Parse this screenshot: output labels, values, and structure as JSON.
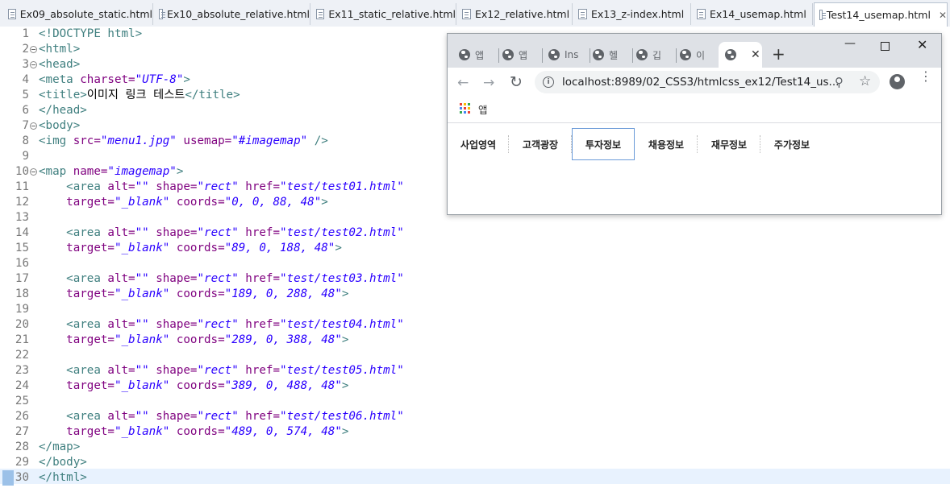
{
  "editor_tabs": [
    {
      "label": "Ex09_absolute_static.html",
      "active": false
    },
    {
      "label": "Ex10_absolute_relative.html",
      "active": false
    },
    {
      "label": "Ex11_static_relative.html",
      "active": false
    },
    {
      "label": "Ex12_relative.html",
      "active": false
    },
    {
      "label": "Ex13_z-index.html",
      "active": false
    },
    {
      "label": "Ex14_usemap.html",
      "active": false
    },
    {
      "label": "Test14_usemap.html",
      "active": true
    }
  ],
  "close_glyph": "✕",
  "code": {
    "line_numbers": [
      "1",
      "2",
      "3",
      "4",
      "5",
      "6",
      "7",
      "8",
      "9",
      "10",
      "11",
      "12",
      "13",
      "14",
      "15",
      "16",
      "17",
      "18",
      "19",
      "20",
      "21",
      "22",
      "23",
      "24",
      "25",
      "26",
      "27",
      "28",
      "29",
      "30"
    ],
    "line_1": "<!DOCTYPE html>",
    "line_2": "<html>",
    "line_3": "<head>",
    "line_4_tag": "<meta",
    "line_4_attr": " charset=",
    "line_4_val": "\"UTF-8\"",
    "line_4_end": ">",
    "line_5_open": "<title>",
    "line_5_text": "이미지 링크 테스트",
    "line_5_close": "</title>",
    "line_6": "</head>",
    "line_7": "<body>",
    "line_8_tag": "<img",
    "line_8_attr1": " src=",
    "line_8_val1": "\"menu1.jpg\"",
    "line_8_attr2": " usemap=",
    "line_8_val2": "\"#imagemap\"",
    "line_8_end": " />",
    "line_10_tag": "<map",
    "line_10_attr": " name=",
    "line_10_val": "\"imagemap\"",
    "line_10_end": ">",
    "areas": [
      {
        "href": "\"test/test01.html\"",
        "coords": "\"0, 0, 88, 48\""
      },
      {
        "href": "\"test/test02.html\"",
        "coords": "\"89, 0, 188, 48\""
      },
      {
        "href": "\"test/test03.html\"",
        "coords": "\"189, 0, 288, 48\""
      },
      {
        "href": "\"test/test04.html\"",
        "coords": "\"289, 0, 388, 48\""
      },
      {
        "href": "\"test/test05.html\"",
        "coords": "\"389, 0, 488, 48\""
      },
      {
        "href": "\"test/test06.html\"",
        "coords": "\"489, 0, 574, 48\""
      }
    ],
    "area_tag": "    <area",
    "area_alt_attr": " alt=",
    "area_alt_val": "\"\"",
    "area_shape_attr": " shape=",
    "area_shape_val": "\"rect\"",
    "area_href_attr": " href=",
    "area_target_indent": "    ",
    "area_target_attr": "target=",
    "area_target_val": "\"_blank\"",
    "area_coords_attr": " coords=",
    "area_end": ">",
    "line_28": "</map>",
    "line_29": "</body>",
    "line_30": "</html>"
  },
  "browser": {
    "tabs": [
      {
        "label": "앱"
      },
      {
        "label": "앱"
      },
      {
        "label": "Ins"
      },
      {
        "label": "헬"
      },
      {
        "label": "깁"
      },
      {
        "label": "이"
      }
    ],
    "active_tab_close": "✕",
    "new_tab": "+",
    "window_controls": {
      "minimize": "—",
      "close": "✕"
    },
    "nav": {
      "back": "←",
      "forward": "→",
      "reload": "↻"
    },
    "url": "localhost:8989/02_CSS3/htmlcss_ex12/Test14_us...",
    "info_glyph": "i",
    "zoom_glyph": "⚲",
    "star_glyph": "☆",
    "kebab_glyph": "⋮",
    "bookmarks_label": "앱",
    "apps_grid_colors": [
      "#ea4335",
      "#fbbc05",
      "#34a853",
      "#4285f4",
      "#ea4335",
      "#fbbc05",
      "#34a853",
      "#4285f4",
      "#ea4335"
    ],
    "menu_items": [
      "사업영역",
      "고객광장",
      "투자정보",
      "채용정보",
      "재무정보",
      "주가정보"
    ],
    "menu_selected": 2
  }
}
